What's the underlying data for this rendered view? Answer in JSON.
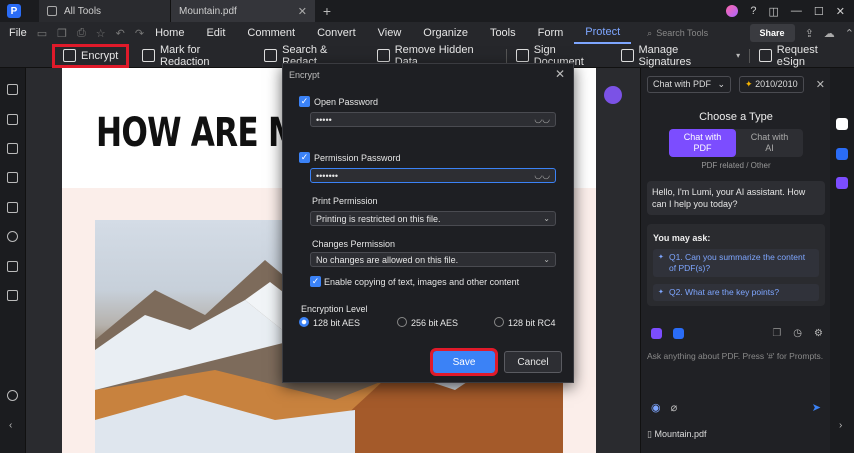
{
  "titlebar": {
    "tabs": [
      {
        "label": "All Tools"
      },
      {
        "label": "Mountain.pdf"
      }
    ]
  },
  "menu": {
    "file": "File",
    "items": [
      "Home",
      "Edit",
      "Comment",
      "Convert",
      "View",
      "Organize",
      "Tools",
      "Form",
      "Protect"
    ],
    "active": "Protect",
    "search_placeholder": "Search Tools",
    "share": "Share"
  },
  "toolbar": {
    "encrypt": "Encrypt",
    "mark_redaction": "Mark for Redaction",
    "search_redact": "Search & Redact",
    "remove_hidden": "Remove Hidden Data",
    "sign_document": "Sign Document",
    "manage_signatures": "Manage Signatures",
    "request_esign": "Request eSign"
  },
  "document": {
    "heading": "HOW ARE MO"
  },
  "dialog": {
    "title": "Encrypt",
    "open_password_label": "Open Password",
    "open_password_value": "•••••",
    "permission_password_label": "Permission Password",
    "permission_password_value": "•••••••",
    "print_permission_label": "Print Permission",
    "print_permission_value": "Printing is restricted on this file.",
    "changes_permission_label": "Changes Permission",
    "changes_permission_value": "No changes are allowed on this file.",
    "copy_label": "Enable copying of text, images and other content",
    "encryption_level_label": "Encryption Level",
    "levels": [
      "128 bit AES",
      "256 bit AES",
      "128 bit RC4"
    ],
    "selected_level": "128 bit AES",
    "save": "Save",
    "cancel": "Cancel"
  },
  "ai_panel": {
    "mode_select": "Chat with PDF",
    "credits": "2010/2010",
    "heading": "Choose a Type",
    "types": [
      {
        "line1": "Chat with",
        "line2": "PDF"
      },
      {
        "line1": "Chat with",
        "line2": "AI"
      }
    ],
    "sub": "PDF related / Other",
    "greeting": "Hello, I'm Lumi, your AI assistant. How can I help you today?",
    "you_may_ask": "You may ask:",
    "questions": [
      "Q1. Can you summarize the content of PDF(s)?",
      "Q2. What are the key points?"
    ],
    "prompt_placeholder": "Ask anything about PDF. Press '#' for Prompts.",
    "file": "Mountain.pdf"
  },
  "colors": {
    "accent": "#3b82f6",
    "highlight": "#e01a2a",
    "ai_purple": "#7c4dff"
  }
}
